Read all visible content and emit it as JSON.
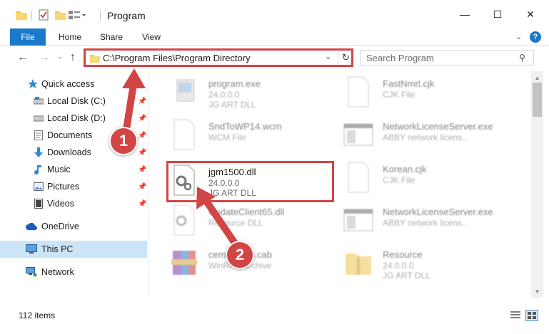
{
  "window": {
    "title": "Program",
    "minimize_glyph": "—",
    "maximize_glyph": "☐",
    "close_glyph": "✕"
  },
  "ribbon": {
    "tabs": [
      "File",
      "Home",
      "Share",
      "View"
    ],
    "expand_glyph": "⌄",
    "help_glyph": "?"
  },
  "nav": {
    "back_glyph": "←",
    "forward_glyph": "→",
    "recent_glyph": "⌄",
    "up_glyph": "↑"
  },
  "address": {
    "path": "C:\\Program Files\\Program Directory",
    "dropdown_glyph": "⌄",
    "refresh_glyph": "↻"
  },
  "search": {
    "placeholder": "Search Program",
    "icon_glyph": "⚲"
  },
  "sidebar": {
    "quick_access": "Quick access",
    "items": [
      {
        "label": "Local Disk (C:)",
        "icon": "drive-icon",
        "pinned": true
      },
      {
        "label": "Local Disk (D:)",
        "icon": "drive-icon",
        "pinned": true
      },
      {
        "label": "Documents",
        "icon": "documents-icon",
        "pinned": true
      },
      {
        "label": "Downloads",
        "icon": "downloads-icon",
        "pinned": true
      },
      {
        "label": "Music",
        "icon": "music-icon",
        "pinned": true
      },
      {
        "label": "Pictures",
        "icon": "pictures-icon",
        "pinned": true
      },
      {
        "label": "Videos",
        "icon": "videos-icon",
        "pinned": true
      }
    ],
    "onedrive": "OneDrive",
    "this_pc": "This PC",
    "network": "Network",
    "pin_glyph": "📌"
  },
  "files": [
    {
      "name": "program.exe",
      "line1": "24.0.0.0",
      "line2": "JG ART DLL",
      "icon": "exe-icon"
    },
    {
      "name": "FastNmrl.cjk",
      "line1": "CJK File",
      "line2": "",
      "icon": "blank-file-icon"
    },
    {
      "name": "SndToWP14.wcm",
      "line1": "WCM File",
      "line2": "",
      "icon": "blank-file-icon"
    },
    {
      "name": "NetworkLicenseServer.exe",
      "line1": "ABBY network licens...",
      "line2": "",
      "icon": "window-exe-icon"
    },
    {
      "name": "jgm1500.dll",
      "line1": "24.0.0.0",
      "line2": "JG ART DLL",
      "icon": "dll-gears-icon"
    },
    {
      "name": "Korean.cjk",
      "line1": "CJK File",
      "line2": "",
      "icon": "blank-file-icon"
    },
    {
      "name": "UpdateClient65.dll",
      "line1": "Resource DLL",
      "line2": "",
      "icon": "dll-gears-icon"
    },
    {
      "name": "NetworkLicenseServer.exe",
      "line1": "ABBY network licens...",
      "line2": "",
      "icon": "window-exe-icon"
    },
    {
      "name": "cemaxxxxs.cab",
      "line1": "WinRAR archive",
      "line2": "",
      "icon": "winrar-icon"
    },
    {
      "name": "Resource",
      "line1": "24.0.0.0",
      "line2": "JG ART DLL",
      "icon": "folder-zip-icon"
    }
  ],
  "status": {
    "item_count": "112 items"
  },
  "annotations": {
    "step1": "1",
    "step2": "2",
    "color": "#d24545"
  },
  "colors": {
    "accent": "#1979ca",
    "selection": "#cce4f7",
    "highlight": "#d24545"
  }
}
